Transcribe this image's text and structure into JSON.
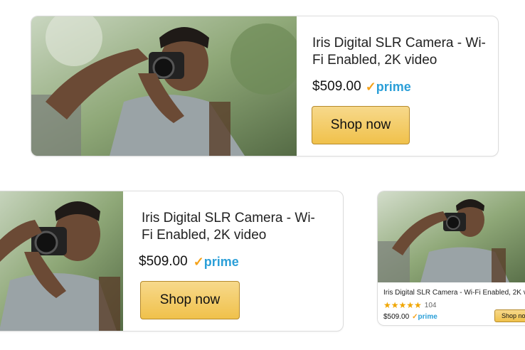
{
  "product": {
    "title": "Iris Digital SLR Camera - Wi-Fi Enabled, 2K video",
    "title_short": "Iris Digital SLR Camera - Wi-Fi Enabled, 2K video",
    "price": "$509.00",
    "prime_label": "prime",
    "cta_label": "Shop now",
    "rating_stars": "★★★★★",
    "rating_count": "104"
  },
  "colors": {
    "button": "#f0c14b",
    "prime": "#2b9fd8",
    "prime_check": "#f4a21a"
  },
  "icons": {
    "photo": "camera-photographer-image",
    "prime_check": "prime-check-icon"
  }
}
